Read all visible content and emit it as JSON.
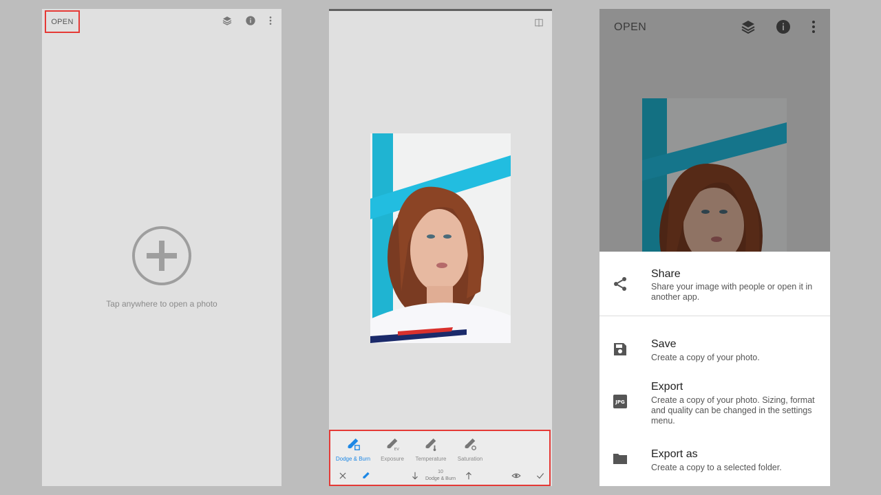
{
  "panel1": {
    "open_label": "OPEN",
    "tap_text": "Tap anywhere to open a photo",
    "icons": [
      "layers-icon",
      "info-icon",
      "more-vert-icon"
    ]
  },
  "panel2": {
    "tools": [
      {
        "label": "Dodge & Burn",
        "active": true
      },
      {
        "label": "Exposure",
        "active": false
      },
      {
        "label": "Temperature",
        "active": false
      },
      {
        "label": "Saturation",
        "active": false
      }
    ],
    "zoom_value": "10",
    "zoom_label": "Dodge & Burn",
    "accent": "#1e88e5"
  },
  "panel3": {
    "open_label": "OPEN",
    "menu": [
      {
        "title": "Share",
        "desc": "Share your image with people or open it in another app.",
        "icon": "share-icon"
      },
      {
        "title": "Save",
        "desc": "Create a copy of your photo.",
        "icon": "save-icon"
      },
      {
        "title": "Export",
        "desc": "Create a copy of your photo. Sizing, format and quality can be changed in the settings menu.",
        "icon": "jpg-icon",
        "icon_text": "JPG"
      },
      {
        "title": "Export as",
        "desc": "Create a copy to a selected folder.",
        "icon": "folder-icon"
      }
    ]
  },
  "colors": {
    "highlight": "#e53935",
    "panel_bg": "#e0e0e0",
    "backdrop": "#bdbdbd"
  }
}
